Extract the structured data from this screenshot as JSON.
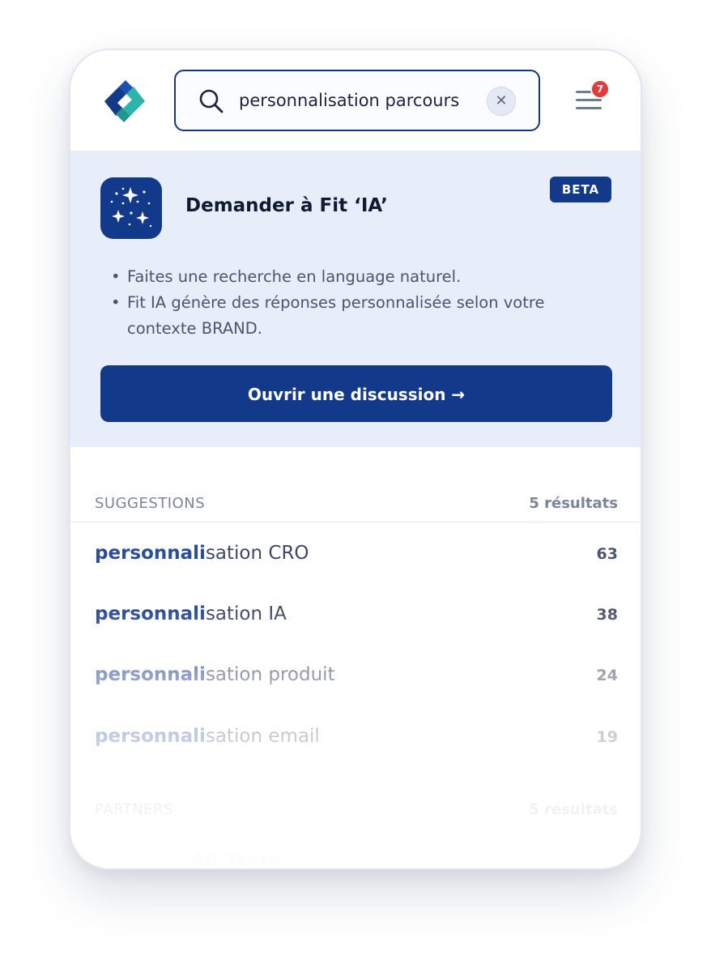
{
  "header": {
    "logo_name": "brand-logo",
    "search": {
      "value": "personnalisation parcours",
      "placeholder": ""
    },
    "clear_label": "✕",
    "notification_count": "7"
  },
  "ai_panel": {
    "title": "Demander à Fit ‘IA’",
    "badge": "BETA",
    "bullets": [
      "Faites une recherche en language naturel.",
      "Fit IA génère des réponses personnalisée selon votre contexte BRAND."
    ],
    "cta_label": "Ouvrir une discussion →"
  },
  "suggestions": {
    "label": "SUGGESTIONS",
    "count": "5 résultats",
    "items": [
      {
        "match": "personnali",
        "rest": "sation CRO",
        "count": "63"
      },
      {
        "match": "personnali",
        "rest": "sation IA",
        "count": "38"
      },
      {
        "match": "personnali",
        "rest": "sation produit",
        "count": "24"
      },
      {
        "match": "personnali",
        "rest": "sation email",
        "count": "19"
      }
    ]
  },
  "partners": {
    "label": "PARTNERS",
    "count": "5 résultats",
    "items": [
      {
        "logo_text": "OUTIL",
        "name": "AB Tasty"
      }
    ]
  },
  "colors": {
    "brand": "#12398a",
    "brand_accent": "#2bb5a8",
    "panel_bg": "#e7eef9",
    "badge_red": "#e23b3b"
  }
}
